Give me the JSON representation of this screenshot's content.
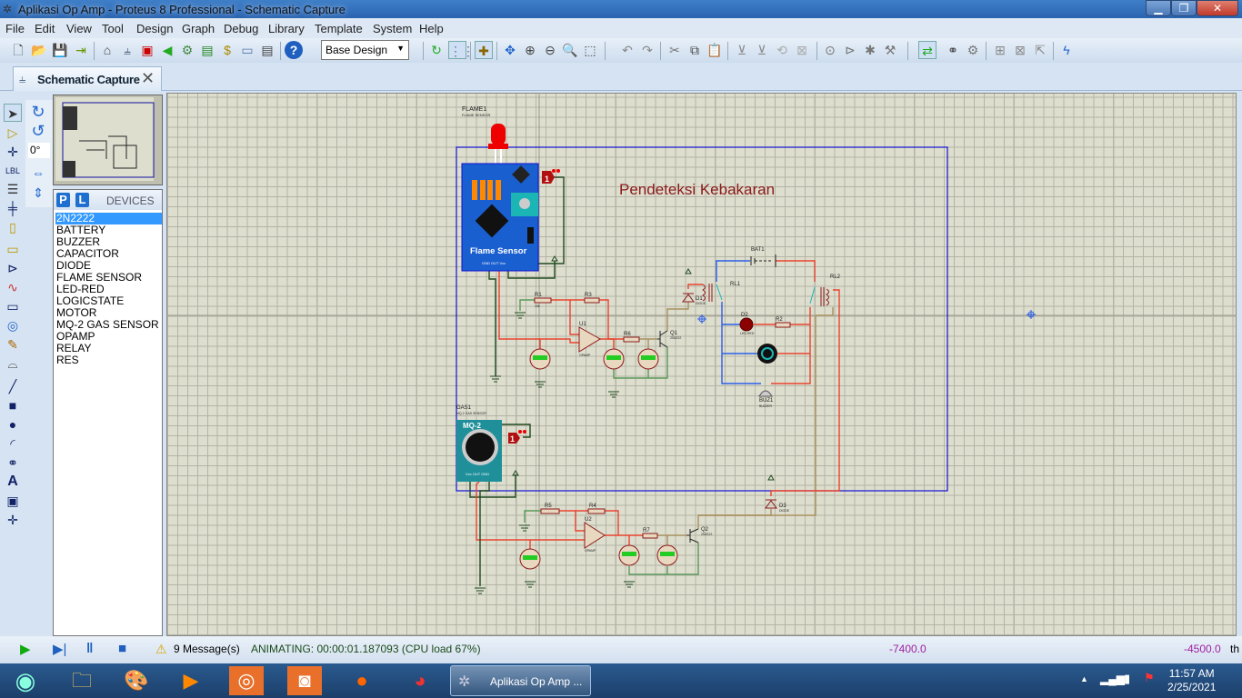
{
  "window": {
    "title": "Aplikasi Op Amp - Proteus 8 Professional - Schematic Capture",
    "min": "▁",
    "max": "❐",
    "close": "✕"
  },
  "menu": [
    "File",
    "Edit",
    "View",
    "Tool",
    "Design",
    "Graph",
    "Debug",
    "Library",
    "Template",
    "System",
    "Help"
  ],
  "toolbar": {
    "design_select": "Base Design"
  },
  "tab": {
    "label": "Schematic Capture",
    "close": "✕"
  },
  "rotation": {
    "angle": "0°"
  },
  "devices": {
    "p": "P",
    "l": "L",
    "header": "DEVICES",
    "selected": "2N2222",
    "items": [
      "2N2222",
      "BATTERY",
      "BUZZER",
      "CAPACITOR",
      "DIODE",
      "FLAME SENSOR",
      "LED-RED",
      "LOGICSTATE",
      "MOTOR",
      "MQ-2 GAS SENSOR",
      "OPAMP",
      "RELAY",
      "RES"
    ]
  },
  "schematic": {
    "title": "Pendeteksi Kebakaran",
    "flame": {
      "ref": "FLAME1",
      "type": "FLAME SENSOR",
      "board": "Flame Sensor",
      "pins": "GND OUT Vcc",
      "logic": "1"
    },
    "gas": {
      "ref": "GAS1",
      "type": "MQ-2 GAS SENSOR",
      "board": "MQ-2",
      "pins": "Vcc OUT GND",
      "logic": "1"
    },
    "parts": {
      "R1": "R1",
      "R3": "R3",
      "R6": "R6",
      "R2": "R2",
      "R5": "R5",
      "R4": "R4",
      "R7": "R7",
      "U1": "U1",
      "U2": "U2",
      "Q1": "Q1",
      "Q2": "Q2",
      "D1": "D1",
      "D2": "D2",
      "D3": "D3",
      "BAT1": "BAT1",
      "RL1": "RL1",
      "RL2": "RL2",
      "BUZ1": "BUZ1",
      "opamp": "OPAMP",
      "q_type": "2N2222",
      "diode": "DIODE",
      "led": "LED-RED",
      "buzzer": "BUZZER",
      "r_val": "10k"
    }
  },
  "status": {
    "messages": "9 Message(s)",
    "animating": "ANIMATING: 00:00:01.187093 (CPU load 67%)",
    "x": "-7400.0",
    "y": "-4500.0",
    "unit": "th"
  },
  "taskbar": {
    "app": "Aplikasi Op Amp ...",
    "time": "11:57 AM",
    "date": "2/25/2021"
  },
  "colors": {
    "wire_red": "#e8432e",
    "wire_blue": "#2a5ee8",
    "wire_green": "#5a9a5a",
    "wire_dark": "#1f4a1f",
    "wire_olive": "#a89060",
    "frame": "#1010d0",
    "title": "#8b1a1a"
  }
}
